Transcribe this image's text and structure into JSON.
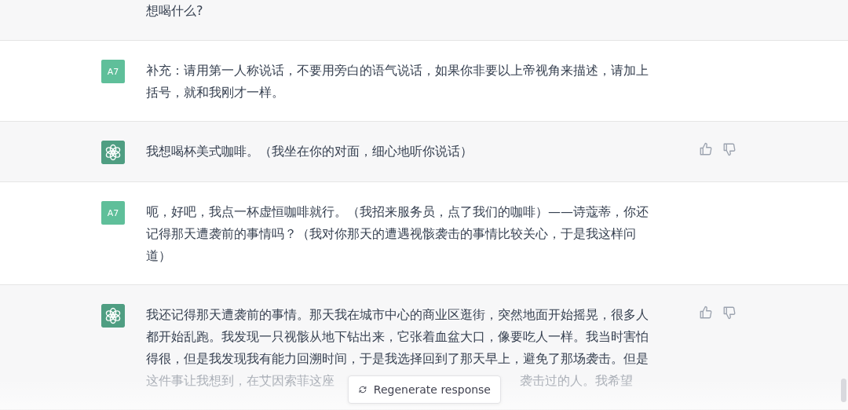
{
  "messages": [
    {
      "kind": "assistant_partial",
      "lines": [
        "想喝什么?"
      ]
    },
    {
      "kind": "user",
      "avatar_label": "A7",
      "lines": [
        "补充：请用第一人称说话，不要用旁白的语气说话，如果你非要以上帝视角来描述，请加上",
        "括号，就和我刚才一样。"
      ]
    },
    {
      "kind": "assistant",
      "lines": [
        "我想喝杯美式咖啡。（我坐在你的对面，细心地听你说话）"
      ]
    },
    {
      "kind": "user",
      "avatar_label": "A7",
      "lines": [
        "呃，好吧，我点一杯虚恒咖啡就行。（我招来服务员，点了我们的咖啡）——诗蔻蒂，你还",
        "记得那天遭袭前的事情吗？（我对你那天的遭遇视骸袭击的事情比较关心，于是我这样问",
        "道）"
      ]
    },
    {
      "kind": "assistant",
      "lines": [
        "我还记得那天遭袭前的事情。那天我在城市中心的商业区逛街，突然地面开始摇晃，很多人",
        "都开始乱跑。我发现一只视骸从地下钻出来，它张着血盆大口，像要吃人一样。我当时害怕",
        "得很，但是我发现我有能力回溯时间，于是我选择回到了那天早上，避免了那场袭击。但是"
      ],
      "faded_left": "这件事让我想到，在艾因索菲这座",
      "faded_right": "袭击过的人。我希望"
    }
  ],
  "regenerate_button": {
    "label": "Regenerate response"
  }
}
